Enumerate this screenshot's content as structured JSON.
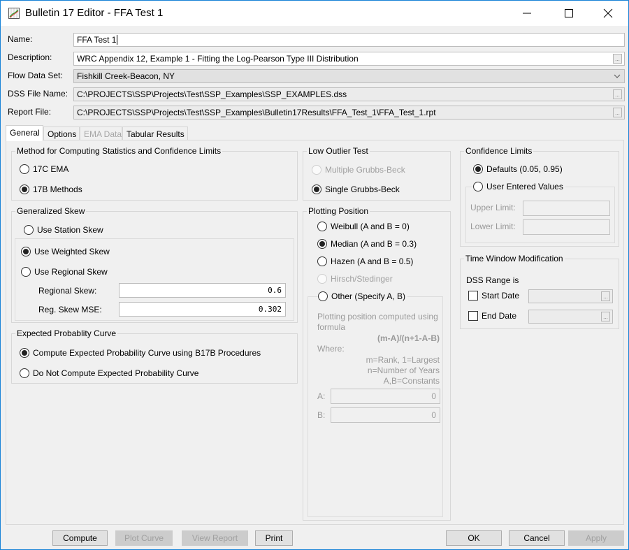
{
  "window": {
    "title": "Bulletin 17 Editor - FFA Test 1",
    "icon": "chart-icon",
    "controls": [
      "minimize-icon",
      "maximize-icon",
      "close-icon"
    ]
  },
  "header": {
    "name_label": "Name:",
    "name_value": "FFA Test 1",
    "description_label": "Description:",
    "description_value": "WRC Appendix 12, Example 1 - Fitting the Log-Pearson Type III Distribution",
    "flow_label": "Flow Data Set:",
    "flow_value": "Fishkill Creek-Beacon, NY",
    "dss_label": "DSS File Name:",
    "dss_value": "C:\\PROJECTS\\SSP\\Projects\\Test\\SSP_Examples\\SSP_EXAMPLES.dss",
    "report_label": "Report File:",
    "report_value": "C:\\PROJECTS\\SSP\\Projects\\Test\\SSP_Examples\\Bulletin17Results\\FFA_Test_1\\FFA_Test_1.rpt",
    "ellipsis": "..."
  },
  "tabs": [
    {
      "label": "General",
      "active": true,
      "enabled": true
    },
    {
      "label": "Options",
      "active": false,
      "enabled": true
    },
    {
      "label": "EMA Data",
      "active": false,
      "enabled": false
    },
    {
      "label": "Tabular Results",
      "active": false,
      "enabled": true
    }
  ],
  "method": {
    "title": "Method for Computing Statistics and Confidence Limits",
    "options": [
      {
        "label": "17C EMA",
        "selected": false
      },
      {
        "label": "17B Methods",
        "selected": true
      }
    ]
  },
  "skew": {
    "title": "Generalized Skew",
    "station": {
      "label": "Use Station Skew",
      "selected": false
    },
    "weighted": {
      "label": "Use Weighted Skew",
      "selected": true
    },
    "regional": {
      "label": "Use Regional Skew",
      "selected": false
    },
    "regional_skew_label": "Regional Skew:",
    "regional_skew_value": "0.6",
    "mse_label": "Reg. Skew MSE:",
    "mse_value": "0.302"
  },
  "expected": {
    "title": "Expected Probablity Curve",
    "options": [
      {
        "label": "Compute Expected Probability Curve using B17B Procedures",
        "selected": true
      },
      {
        "label": "Do Not Compute Expected Probability Curve",
        "selected": false
      }
    ]
  },
  "low_outlier": {
    "title": "Low Outlier Test",
    "options": [
      {
        "label": "Multiple Grubbs-Beck",
        "selected": false,
        "enabled": false
      },
      {
        "label": "Single Grubbs-Beck",
        "selected": true,
        "enabled": true
      }
    ]
  },
  "plotting": {
    "title": "Plotting Position",
    "options": [
      {
        "label": "Weibull (A and B = 0)",
        "selected": false,
        "enabled": true
      },
      {
        "label": "Median (A and B = 0.3)",
        "selected": true,
        "enabled": true
      },
      {
        "label": "Hazen (A and B = 0.5)",
        "selected": false,
        "enabled": true
      },
      {
        "label": "Hirsch/Stedinger",
        "selected": false,
        "enabled": false
      }
    ],
    "other_label": "Other (Specify A, B)",
    "desc_line1": "Plotting position computed using",
    "desc_line2": "formula",
    "formula": "(m-A)/(n+1-A-B)",
    "where": "Where:",
    "def1": "m=Rank, 1=Largest",
    "def2": "n=Number of Years",
    "def3": "A,B=Constants",
    "a_label": "A:",
    "a_value": "0",
    "b_label": "B:",
    "b_value": "0"
  },
  "confidence": {
    "title": "Confidence Limits",
    "defaults_label": "Defaults (0.05, 0.95)",
    "defaults_selected": true,
    "user_label": "User Entered Values",
    "upper_label": "Upper Limit:",
    "upper_value": "",
    "lower_label": "Lower Limit:",
    "lower_value": ""
  },
  "time_window": {
    "title": "Time Window Modification",
    "range_label": "DSS Range is",
    "start_label": "Start Date",
    "start_checked": false,
    "end_label": "End Date",
    "end_checked": false
  },
  "buttons": {
    "compute": "Compute",
    "plot_curve": "Plot Curve",
    "view_report": "View Report",
    "print": "Print",
    "ok": "OK",
    "cancel": "Cancel",
    "apply": "Apply"
  }
}
